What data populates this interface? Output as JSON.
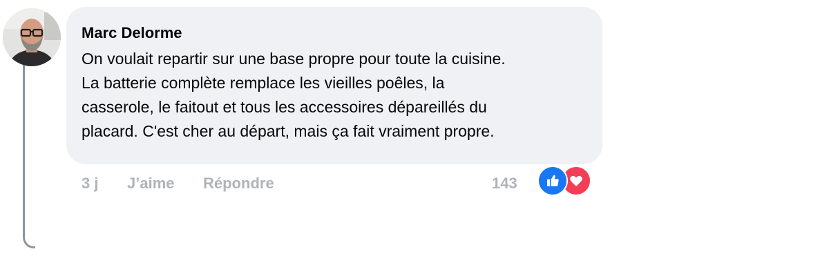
{
  "comment": {
    "author": "Marc Delorme",
    "text_lines": [
      "On voulait repartir sur une base propre pour toute la cuisine.",
      "La batterie complète remplace les vieilles poêles, la",
      "casserole, le faitout et tous les accessoires dépareillés du",
      "placard. C'est cher au départ, mais ça fait vraiment propre."
    ],
    "time": "3 j",
    "like_label": "J’aime",
    "reply_label": "Répondre",
    "reaction_count": "143",
    "reaction_types": [
      "like-icon",
      "love-icon"
    ]
  },
  "colors": {
    "bubble": "#f0f1f5",
    "meta": "#b0b3b8",
    "like": "#1877f2",
    "love": "#f33e58",
    "thread_line": "#8f949c"
  }
}
